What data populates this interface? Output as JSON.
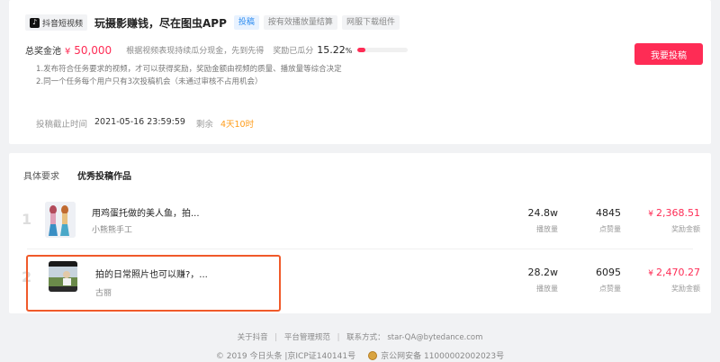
{
  "header": {
    "source_tag": "抖音短视频",
    "source_icon": "tiktok-icon",
    "title": "玩摄影赚钱，尽在图虫APP",
    "tags": [
      "投稿",
      "按有效播放量结算",
      "网服下载组件"
    ]
  },
  "pool": {
    "label": "总奖金池",
    "currency": "¥",
    "amount": "50,000",
    "description": "根据视频表现持续瓜分现金，先到先得",
    "ratio_label": "奖励已瓜分",
    "ratio_value": "15.22",
    "ratio_unit": "%",
    "progress_fraction": 0.1522
  },
  "rules": [
    "1.发布符合任务要求的视频，才可以获得奖励，奖励金额由视频的质量、播放量等综合决定",
    "2.同一个任务每个用户只有3次投稿机会（未通过审核不占用机会）"
  ],
  "deadline": {
    "label": "投稿截止时间",
    "value": "2021-05-16 23:59:59",
    "remaining_label": "剩余",
    "remaining_value": "4天10时"
  },
  "submit_button": "我要投稿",
  "tabs": [
    {
      "label": "具体要求",
      "active": false
    },
    {
      "label": "优秀投稿作品",
      "active": true
    }
  ],
  "works": [
    {
      "rank": "1",
      "title": "用鸡蛋托做的美人鱼，拍...",
      "author": "小熊熊手工",
      "plays": "24.8w",
      "plays_label": "播放量",
      "likes": "4845",
      "likes_label": "点赞量",
      "reward_currency": "¥",
      "reward": "2,368.51",
      "reward_label": "奖励金额"
    },
    {
      "rank": "2",
      "title": "拍的日常照片也可以赚?，...",
      "author": "古丽",
      "plays": "28.2w",
      "plays_label": "播放量",
      "likes": "6095",
      "likes_label": "点赞量",
      "reward_currency": "¥",
      "reward": "2,470.27",
      "reward_label": "奖励金额"
    }
  ],
  "footer": {
    "links": [
      "关于抖音",
      "平台管理规范"
    ],
    "contact": "联系方式：",
    "email": "star-QA@bytedance.com",
    "copyright": "© 2019 今日头条 |京ICP证140141号",
    "police": "京公网安备 11000002002023号"
  },
  "colors": {
    "accent": "#fe2c55",
    "highlight_box": "#f05a2a",
    "remaining": "#ff9c1a"
  }
}
